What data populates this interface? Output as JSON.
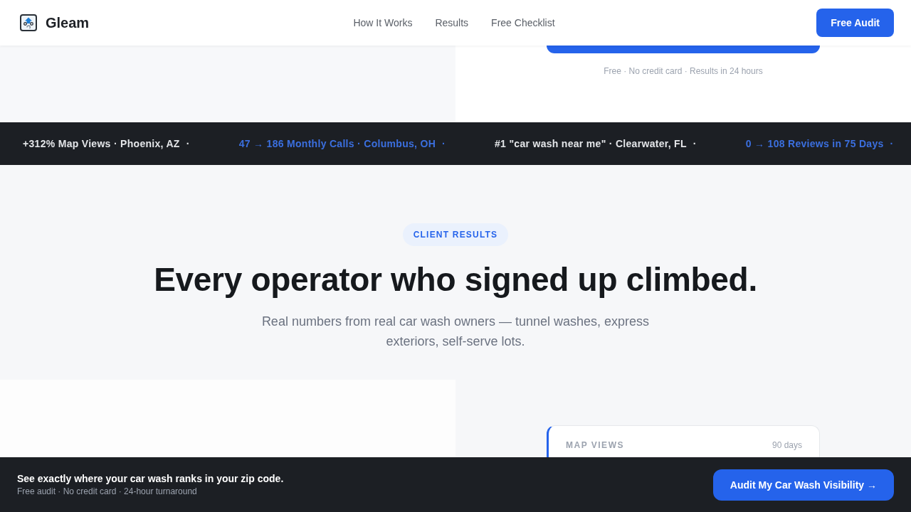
{
  "header": {
    "brand": "Gleam",
    "nav": [
      "How It Works",
      "Results",
      "Free Checklist"
    ],
    "cta": "Free Audit"
  },
  "hero": {
    "note": "Free · No credit card · Results in 24 hours"
  },
  "ticker": [
    {
      "text": "+312% Map Views · Phoenix, AZ",
      "separator": "·",
      "accent": false
    },
    {
      "text": "47 → 186 Monthly Calls · Columbus, OH",
      "separator": "·",
      "accent": true
    },
    {
      "text": "#1 \"car wash near me\" · Clearwater, FL",
      "separator": "·",
      "accent": false
    },
    {
      "text": "0 → 108 Reviews in 75 Days",
      "separator": "·",
      "accent": true
    }
  ],
  "results": {
    "eyebrow": "CLIENT RESULTS",
    "title": "Every operator who signed up climbed.",
    "subtitle": "Real numbers from real car wash owners — tunnel washes, express exteriors, self-serve lots.",
    "card": {
      "label": "MAP VIEWS",
      "period": "90 days"
    }
  },
  "sticky_bar": {
    "headline": "See exactly where your car wash ranks in your zip code.",
    "details": "Free audit · No credit card · 24-hour turnaround",
    "button": "Audit My Car Wash Visibility →"
  }
}
